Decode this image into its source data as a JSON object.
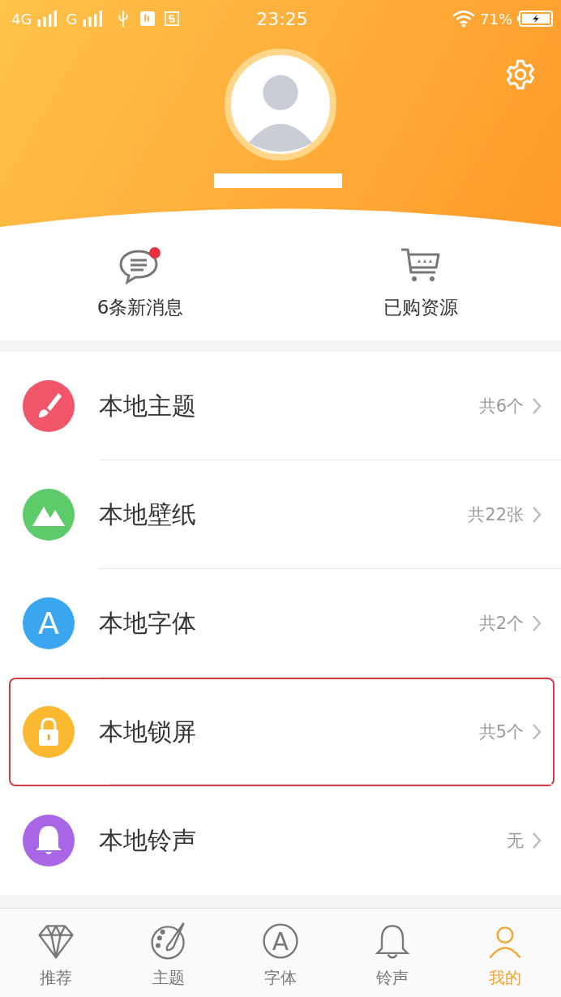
{
  "status_bar": {
    "network_1": "4G",
    "network_2": "G",
    "time": "23:25",
    "battery": "71%"
  },
  "quick_links": [
    {
      "kind": "messages",
      "label": "6条新消息",
      "unread": true
    },
    {
      "kind": "cart",
      "label": "已购资源"
    }
  ],
  "local_items": [
    {
      "kind": "brush",
      "title": "本地主题",
      "count": "共6个",
      "color": "#f0556a",
      "highlighted": false
    },
    {
      "kind": "mountain",
      "title": "本地壁纸",
      "count": "共22张",
      "color": "#5ecb6b",
      "highlighted": false
    },
    {
      "kind": "letter",
      "glyph": "A",
      "title": "本地字体",
      "count": "共2个",
      "color": "#3aa6f0",
      "highlighted": false
    },
    {
      "kind": "lock",
      "title": "本地锁屏",
      "count": "共5个",
      "color": "#fbb932",
      "highlighted": true
    },
    {
      "kind": "bell",
      "title": "本地铃声",
      "count": "无",
      "color": "#a866e6",
      "highlighted": false
    }
  ],
  "tabs": [
    {
      "kind": "diamond",
      "label": "推荐",
      "selected": false
    },
    {
      "kind": "palette",
      "label": "主题",
      "selected": false
    },
    {
      "kind": "font",
      "glyph": "A",
      "label": "字体",
      "selected": false
    },
    {
      "kind": "bell",
      "label": "铃声",
      "selected": false
    },
    {
      "kind": "person",
      "label": "我的",
      "selected": true
    }
  ]
}
